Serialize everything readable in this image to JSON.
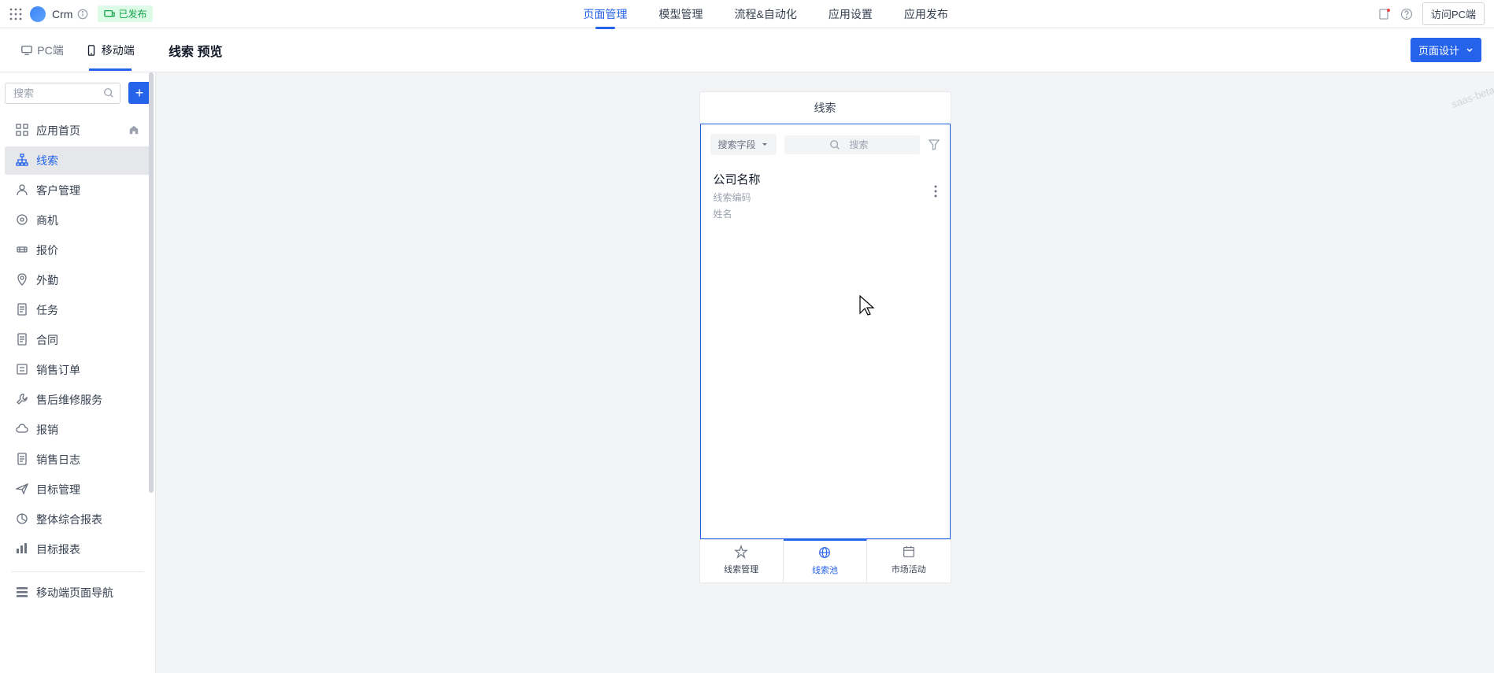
{
  "header": {
    "appName": "Crm",
    "statusLabel": "已发布",
    "nav": [
      "页面管理",
      "模型管理",
      "流程&自动化",
      "应用设置",
      "应用发布"
    ],
    "activeNav": 0,
    "visitLabel": "访问PC端"
  },
  "platformTabs": {
    "pc": "PC端",
    "mobile": "移动端"
  },
  "contentHeader": {
    "title": "线索 预览",
    "designBtn": "页面设计"
  },
  "sidebar": {
    "searchPlaceholder": "搜索",
    "items": [
      {
        "label": "应用首页",
        "icon": "grid",
        "hasHome": true
      },
      {
        "label": "线索",
        "icon": "sitemap",
        "active": true
      },
      {
        "label": "客户管理",
        "icon": "user"
      },
      {
        "label": "商机",
        "icon": "target"
      },
      {
        "label": "报价",
        "icon": "tag"
      },
      {
        "label": "外勤",
        "icon": "location"
      },
      {
        "label": "任务",
        "icon": "doc"
      },
      {
        "label": "合同",
        "icon": "doc"
      },
      {
        "label": "销售订单",
        "icon": "list"
      },
      {
        "label": "售后维修服务",
        "icon": "wrench"
      },
      {
        "label": "报销",
        "icon": "cloud"
      },
      {
        "label": "销售日志",
        "icon": "doc"
      },
      {
        "label": "目标管理",
        "icon": "send"
      },
      {
        "label": "整体综合报表",
        "icon": "chart"
      },
      {
        "label": "目标报表",
        "icon": "bars"
      }
    ],
    "footer": "移动端页面导航"
  },
  "mobile": {
    "title": "线索",
    "fieldSelect": "搜索字段",
    "searchPlaceholder": "搜索",
    "card": {
      "title": "公司名称",
      "sub1": "线索编码",
      "sub2": "姓名"
    },
    "bottomNav": [
      {
        "label": "线索管理",
        "icon": "star"
      },
      {
        "label": "线索池",
        "icon": "globe",
        "active": true
      },
      {
        "label": "市场活动",
        "icon": "calendar"
      }
    ]
  },
  "watermark": "saas-beta"
}
